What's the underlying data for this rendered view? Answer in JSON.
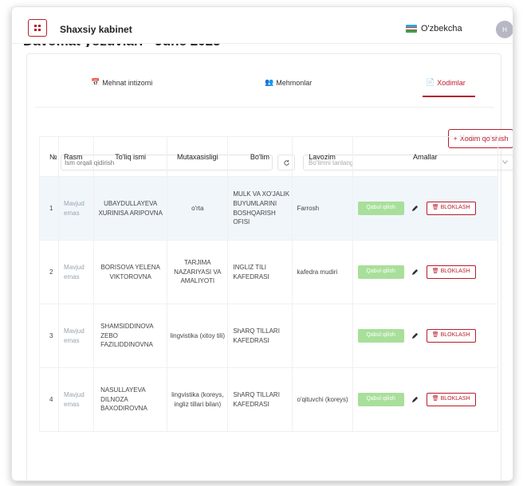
{
  "header": {
    "title": "Shaxsiy kabinet",
    "language": "O'zbekcha",
    "avatar_letter": "H",
    "bg_title": "Davomat yozuvlari - June 2025"
  },
  "tabs": [
    {
      "label": "Mehnat intizomi",
      "icon": "calendar-icon"
    },
    {
      "label": "Mehmonlar",
      "icon": "users-icon"
    },
    {
      "label": "Xodimlar",
      "icon": "document-icon",
      "active": true
    }
  ],
  "toolbar": {
    "add_label": "Xodim qo'shish",
    "search_placeholder": "Ism orqali qidirish",
    "select_placeholder": "Bo'limni tanlang"
  },
  "table": {
    "headers": [
      "№",
      "Rasm",
      "To'liq ismi",
      "Mutaxasisligi",
      "Bo'lim",
      "Lavozim",
      "Amallar"
    ],
    "rows": [
      {
        "n": "1",
        "photo": "Mavjud emas",
        "name": "UBAYDULLAYEVA XURINISA ARIPOVNA",
        "spec": "o'rta",
        "dept": "MULK VA XO'JALIK BUYUMLARINI BOSHQARISH OFISI",
        "position": "Farrosh"
      },
      {
        "n": "2",
        "photo": "Mavjud emas",
        "name": "BORISOVA YELENA VIKTOROVNA",
        "spec": "TARJIMA NAZARIYASI VA AMALIYOTI",
        "dept": "INGLIZ TILI KAFEDRASI",
        "position": "kafedra mudiri"
      },
      {
        "n": "3",
        "photo": "Mavjud emas",
        "name": "SHAMSIDDINOVA ZEBO FAZILIDDINOVNA",
        "spec": "lingvistika (xitoy tili)",
        "dept": "ShARQ TILLARI KAFEDRASI",
        "position": ""
      },
      {
        "n": "4",
        "photo": "Mavjud emas",
        "name": "NASULLAYEVA DILNOZA BAXODIROVNA",
        "spec": "lingvistika (koreys, ingliz tillari bilan)",
        "dept": "ShARQ TILLARI KAFEDRASI",
        "position": "o'qituvchi (koreys)"
      }
    ],
    "accept_label": "Qabul qilish",
    "block_label": "BLOKLASH"
  },
  "colors": {
    "accent": "#b71c2c",
    "accept": "#a8df9a",
    "highlight_row": "#f1f6fb"
  }
}
